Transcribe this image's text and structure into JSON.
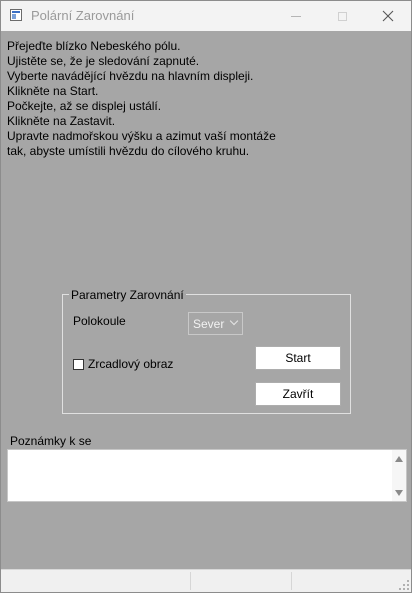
{
  "window": {
    "title": "Polární Zarovnání"
  },
  "instructions": [
    "Přejeďte blízko Nebeského pólu.",
    "Ujistěte se, že je sledování zapnuté.",
    "Vyberte navádějící hvězdu na hlavním displeji.",
    "Klikněte na Start.",
    "Počkejte, až se displej ustálí.",
    "Klikněte na Zastavit.",
    "Upravte nadmořskou výšku a azimut vaší montáže",
    "tak, abyste umístili hvězdu do cílového kruhu."
  ],
  "params": {
    "legend": "Parametry Zarovnání",
    "hemisphere_label": "Polokoule",
    "hemisphere_value": "Sever",
    "mirror_label": "Zrcadlový obraz",
    "mirror_checked": false,
    "start_label": "Start",
    "close_label": "Zavřít"
  },
  "notes": {
    "label": "Poznámky k se",
    "value": ""
  },
  "icons": {
    "app": "app-window-icon",
    "minimize": "minimize-icon",
    "maximize": "maximize-icon",
    "close": "close-icon"
  },
  "colors": {
    "background": "#a6a6a6",
    "titlebar": "#f3f3f3",
    "button": "#ffffff"
  }
}
